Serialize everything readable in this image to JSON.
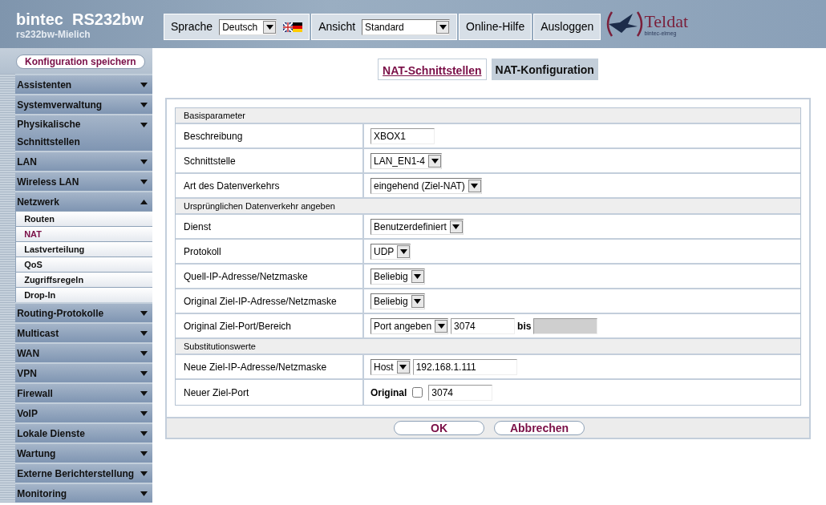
{
  "header": {
    "title": "bintec  RS232bw",
    "subtitle": "rs232bw-Mielich",
    "language_label": "Sprache",
    "language_value": "Deutsch",
    "view_label": "Ansicht",
    "view_value": "Standard",
    "buttons": [
      "Online-Hilfe",
      "Ausloggen"
    ],
    "logo": {
      "name": "Teldat",
      "tagline": "bintec-elmeg"
    }
  },
  "save_button": "Konfiguration speichern",
  "sidebar": {
    "items": [
      {
        "label": "Assistenten",
        "expanded": false
      },
      {
        "label": "Systemverwaltung",
        "expanded": false
      },
      {
        "label": "Physikalische Schnittstellen",
        "expanded": false
      },
      {
        "label": "LAN",
        "expanded": false
      },
      {
        "label": "Wireless LAN",
        "expanded": false
      },
      {
        "label": "Netzwerk",
        "expanded": true,
        "children": [
          {
            "label": "Routen",
            "selected": false
          },
          {
            "label": "NAT",
            "selected": true
          },
          {
            "label": "Lastverteilung",
            "selected": false
          },
          {
            "label": "QoS",
            "selected": false
          },
          {
            "label": "Zugriffsregeln",
            "selected": false
          },
          {
            "label": "Drop-In",
            "selected": false
          }
        ]
      },
      {
        "label": "Routing-Protokolle",
        "expanded": false
      },
      {
        "label": "Multicast",
        "expanded": false
      },
      {
        "label": "WAN",
        "expanded": false
      },
      {
        "label": "VPN",
        "expanded": false
      },
      {
        "label": "Firewall",
        "expanded": false
      },
      {
        "label": "VoIP",
        "expanded": false
      },
      {
        "label": "Lokale Dienste",
        "expanded": false
      },
      {
        "label": "Wartung",
        "expanded": false
      },
      {
        "label": "Externe Berichterstellung",
        "expanded": false
      },
      {
        "label": "Monitoring",
        "expanded": false
      }
    ]
  },
  "tabs": [
    {
      "label": "NAT-Schnittstellen",
      "selected": false
    },
    {
      "label": "NAT-Konfiguration",
      "selected": true
    }
  ],
  "form": {
    "sections": [
      {
        "title": "Basisparameter",
        "rows": [
          {
            "label": "Beschreibung",
            "controls": [
              {
                "kind": "input",
                "value": "XBOX1"
              }
            ]
          },
          {
            "label": "Schnittstelle",
            "controls": [
              {
                "kind": "select",
                "value": "LAN_EN1-4"
              }
            ]
          },
          {
            "label": "Art des Datenverkehrs",
            "controls": [
              {
                "kind": "select",
                "value": "eingehend (Ziel-NAT)"
              }
            ]
          }
        ]
      },
      {
        "title": "Ursprünglichen Datenverkehr angeben",
        "rows": [
          {
            "label": "Dienst",
            "controls": [
              {
                "kind": "select",
                "value": "Benutzerdefiniert"
              }
            ]
          },
          {
            "label": "Protokoll",
            "controls": [
              {
                "kind": "select",
                "value": "UDP"
              }
            ]
          },
          {
            "label": "Quell-IP-Adresse/Netzmaske",
            "controls": [
              {
                "kind": "select",
                "value": "Beliebig"
              }
            ]
          },
          {
            "label": "Original Ziel-IP-Adresse/Netzmaske",
            "controls": [
              {
                "kind": "select",
                "value": "Beliebig"
              }
            ]
          },
          {
            "label": "Original Ziel-Port/Bereich",
            "controls": [
              {
                "kind": "select",
                "value": "Port angeben"
              },
              {
                "kind": "input",
                "value": "3074"
              },
              {
                "kind": "text",
                "value": "bis"
              },
              {
                "kind": "input",
                "disabled": true
              }
            ]
          }
        ]
      },
      {
        "title": "Substitutionswerte",
        "rows": [
          {
            "label": "Neue Ziel-IP-Adresse/Netzmaske",
            "controls": [
              {
                "kind": "select",
                "value": "Host"
              },
              {
                "kind": "input",
                "value": "192.168.1.111"
              }
            ]
          },
          {
            "label": "Neuer Ziel-Port",
            "controls": [
              {
                "kind": "text",
                "value": "Original"
              },
              {
                "kind": "checkbox",
                "checked": false
              },
              {
                "kind": "input",
                "value": "3074"
              }
            ]
          }
        ]
      }
    ]
  },
  "buttons": [
    "OK",
    "Abbrechen"
  ]
}
